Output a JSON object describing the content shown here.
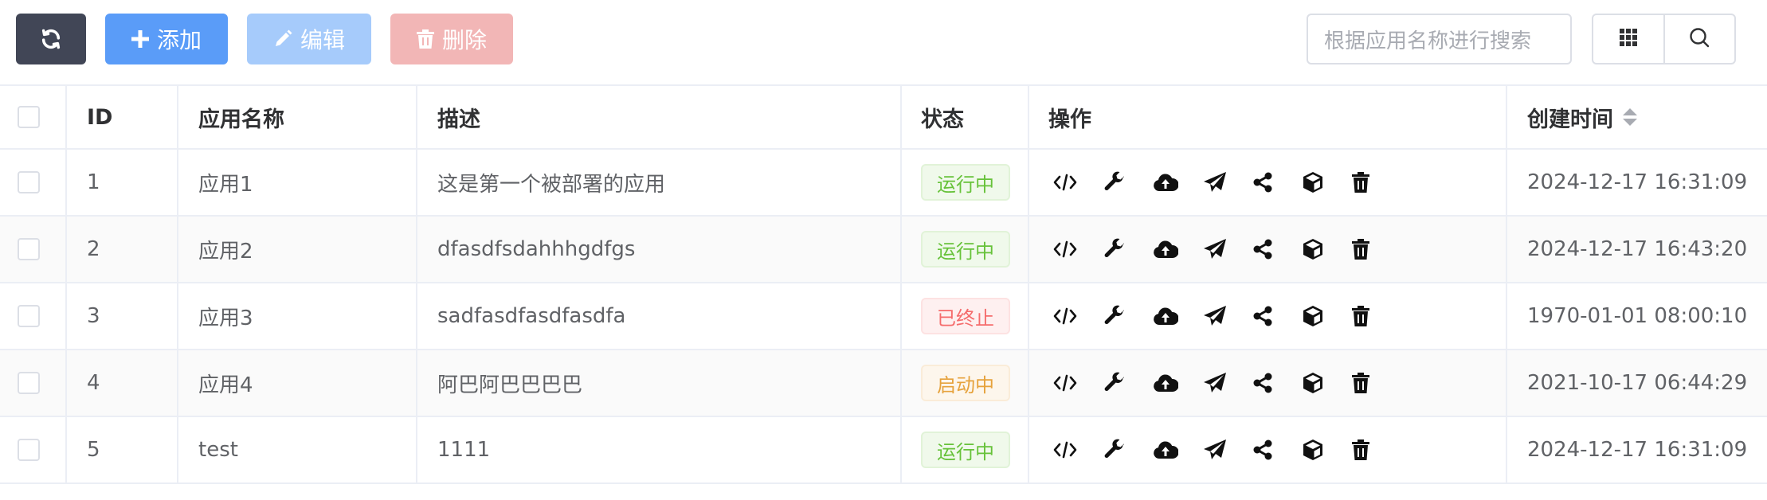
{
  "toolbar": {
    "refresh_icon": "refresh-icon",
    "add_label": "添加",
    "edit_label": "编辑",
    "delete_label": "删除",
    "search_placeholder": "根据应用名称进行搜索",
    "colors": {
      "dark": "#414656",
      "primary": "#5a9cf8",
      "primary_disabled": "#a6cbfb",
      "danger_disabled": "#f2b6b6"
    }
  },
  "table": {
    "headers": {
      "id": "ID",
      "name": "应用名称",
      "description": "描述",
      "status": "状态",
      "actions": "操作",
      "created_at": "创建时间"
    },
    "action_icons": [
      "code-icon",
      "wrench-icon",
      "cloud-upload-icon",
      "send-icon",
      "share-icon",
      "box-icon",
      "trash-icon"
    ],
    "rows": [
      {
        "id": "1",
        "name": "应用1",
        "description": "这是第一个被部署的应用",
        "status": "运行中",
        "status_color": "green",
        "created_at": "2024-12-17 16:31:09"
      },
      {
        "id": "2",
        "name": "应用2",
        "description": "dfasdfsdahhhgdfgs",
        "status": "运行中",
        "status_color": "green",
        "created_at": "2024-12-17 16:43:20"
      },
      {
        "id": "3",
        "name": "应用3",
        "description": "sadfasdfasdfasdfa",
        "status": "已终止",
        "status_color": "red",
        "created_at": "1970-01-01 08:00:10"
      },
      {
        "id": "4",
        "name": "应用4",
        "description": "阿巴阿巴巴巴巴",
        "status": "启动中",
        "status_color": "orange",
        "created_at": "2021-10-17 06:44:29"
      },
      {
        "id": "5",
        "name": "test",
        "description": "1111",
        "status": "运行中",
        "status_color": "green",
        "created_at": "2024-12-17 16:31:09"
      }
    ]
  }
}
